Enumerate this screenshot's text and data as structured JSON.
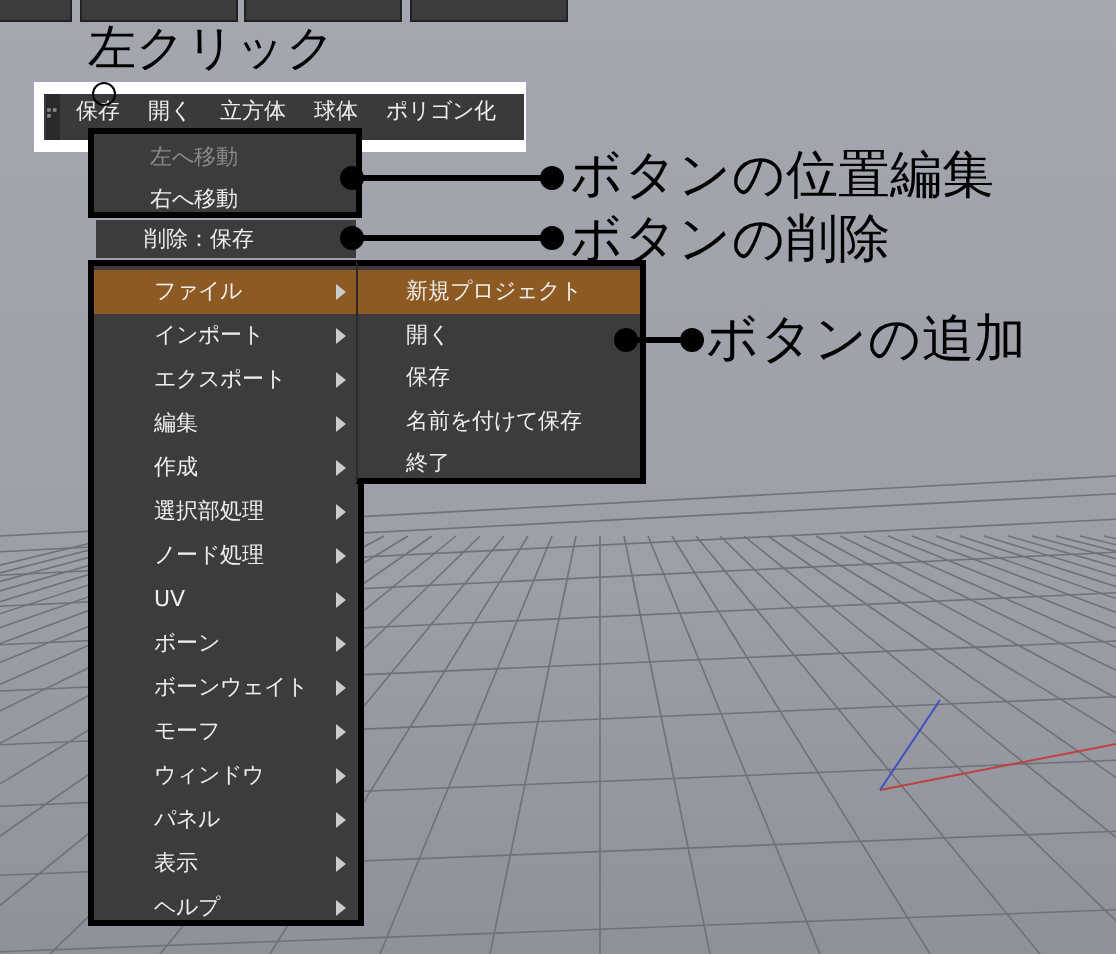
{
  "click_label": "左クリック",
  "quick_bar": {
    "items": [
      "保存",
      "開く",
      "立方体",
      "球体",
      "ポリゴン化"
    ]
  },
  "button_menu": {
    "items": [
      {
        "label": "左へ移動",
        "disabled": true
      },
      {
        "label": "右へ移動",
        "disabled": false
      }
    ]
  },
  "delete_item": "削除：保存",
  "main_menu": {
    "items": [
      {
        "label": "ファイル",
        "selected": true
      },
      {
        "label": "インポート",
        "selected": false
      },
      {
        "label": "エクスポート",
        "selected": false
      },
      {
        "label": "編集",
        "selected": false
      },
      {
        "label": "作成",
        "selected": false
      },
      {
        "label": "選択部処理",
        "selected": false
      },
      {
        "label": "ノード処理",
        "selected": false
      },
      {
        "label": "UV",
        "selected": false
      },
      {
        "label": "ボーン",
        "selected": false
      },
      {
        "label": "ボーンウェイト",
        "selected": false
      },
      {
        "label": "モーフ",
        "selected": false
      },
      {
        "label": "ウィンドウ",
        "selected": false
      },
      {
        "label": "パネル",
        "selected": false
      },
      {
        "label": "表示",
        "selected": false
      },
      {
        "label": "ヘルプ",
        "selected": false
      }
    ]
  },
  "submenu": {
    "items": [
      {
        "label": "新規プロジェクト",
        "selected": true
      },
      {
        "label": "開く",
        "selected": false
      },
      {
        "label": "保存",
        "selected": false
      },
      {
        "label": "名前を付けて保存",
        "selected": false
      },
      {
        "label": "終了",
        "selected": false
      }
    ]
  },
  "callouts": [
    "ボタンの位置編集",
    "ボタンの削除",
    "ボタンの追加"
  ]
}
